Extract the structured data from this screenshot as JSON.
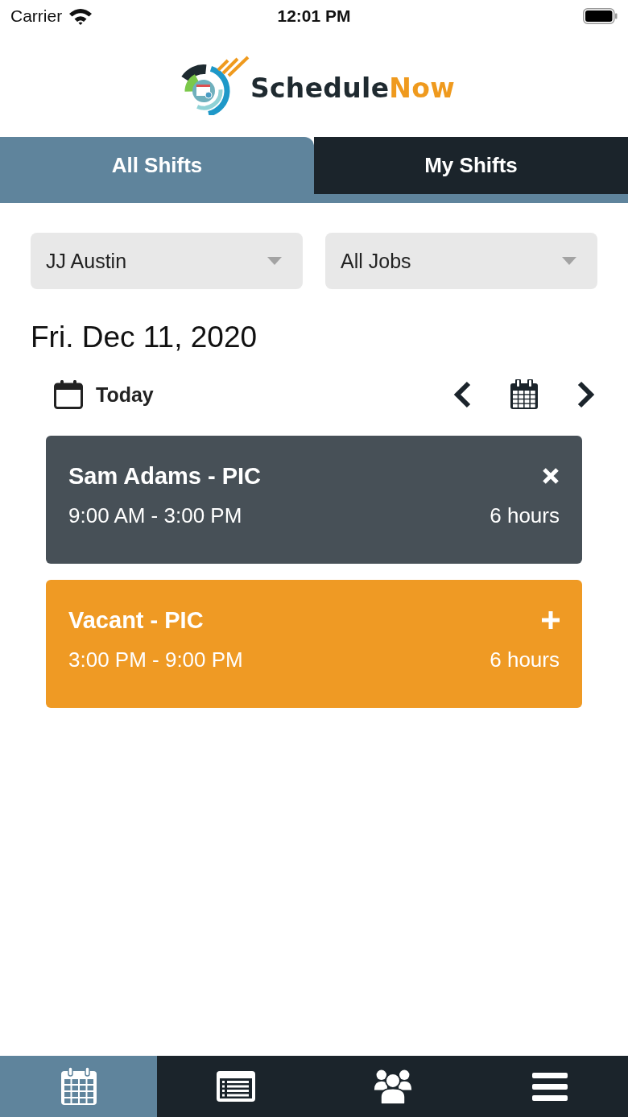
{
  "status_bar": {
    "carrier": "Carrier",
    "time": "12:01 PM"
  },
  "logo": {
    "first_part": "Schedule",
    "second_part": "Now"
  },
  "tabs": [
    {
      "label": "All Shifts",
      "selected": true
    },
    {
      "label": "My Shifts",
      "selected": false
    }
  ],
  "filters": [
    {
      "value": "JJ Austin"
    },
    {
      "value": "All Jobs"
    }
  ],
  "date": "Fri. Dec 11, 2020",
  "today_button": "Today",
  "shifts": [
    {
      "kind": "assigned",
      "title": "Sam Adams - PIC",
      "time": "9:00 AM - 3:00 PM",
      "duration": "6 hours"
    },
    {
      "kind": "vacant",
      "title": "Vacant - PIC",
      "time": "3:00 PM - 9:00 PM",
      "duration": "6 hours"
    }
  ],
  "bottom_nav": [
    {
      "kind": "calendar",
      "selected": true
    },
    {
      "kind": "list",
      "selected": false
    },
    {
      "kind": "people",
      "selected": false
    },
    {
      "kind": "menu",
      "selected": false
    }
  ]
}
